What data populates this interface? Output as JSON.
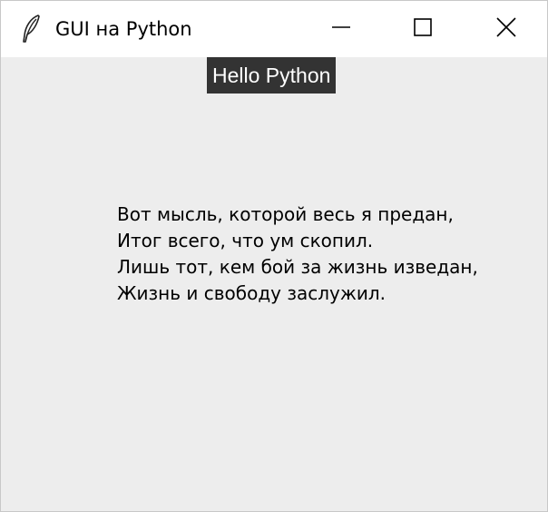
{
  "window": {
    "title": "GUI на Python",
    "icon": "tk-feather-icon"
  },
  "titlebar_buttons": {
    "minimize": "minimize-icon",
    "maximize": "maximize-icon",
    "close": "close-icon"
  },
  "label": {
    "text": "Hello Python",
    "background": "#333333",
    "foreground": "#ffffff"
  },
  "poem": {
    "lines": [
      "Вот мысль, которой весь я предан,",
      "Итог всего, что ум скопил.",
      "Лишь тот, кем бой за жизнь изведан,",
      "Жизнь и свободу заслужил."
    ]
  },
  "colors": {
    "client_background": "#ededed",
    "titlebar_background": "#ffffff"
  }
}
